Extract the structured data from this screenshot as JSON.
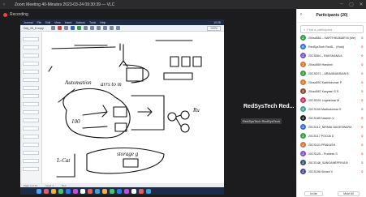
{
  "window": {
    "title": "Zoom Meeting 40-Minutes  2023-03-24 09:30:39 — VLC",
    "controls": [
      "–",
      "▢",
      "✕"
    ]
  },
  "recording": {
    "label": "Recording"
  },
  "shared_app": {
    "menu": [
      "Journal",
      "File",
      "Edit",
      "View",
      "Insert",
      "Actions",
      "Tools",
      "Help"
    ],
    "clock": "10:05",
    "file_name": "Day_26_D.xopp",
    "zoom": "100%",
    "status": [
      "Page 4 of 12",
      "Layer 1",
      "Pen"
    ]
  },
  "speaker": {
    "name": "RedSysTech  Red...",
    "tag": "RedSysTech  RedSysTech"
  },
  "participants_panel": {
    "title": "Participants (20)",
    "search_placeholder": "Find a participant",
    "participants": [
      {
        "initial": "Z",
        "name": "20csd084 – KARTHIKUMAR M (Me)",
        "color": "#3a9a4a"
      },
      {
        "initial": "R",
        "name": "RedSysTech RedS... (Host)",
        "color": "#3b6fd4"
      },
      {
        "initial": "Z",
        "name": "20CS064 – RAKSHANA A",
        "color": "#7a56c7"
      },
      {
        "initial": "Z",
        "name": "20csd069 Harshini",
        "color": "#d1793a"
      },
      {
        "initial": "Z",
        "name": "20CSD71 – ARAVANANDAN B",
        "color": "#3a9a4a"
      },
      {
        "initial": "Z",
        "name": "20csd092 Karthikkumar P",
        "color": "#d1793a"
      },
      {
        "initial": "Z",
        "name": "20csd087 Kavyasri S S",
        "color": "#8b4a3a"
      },
      {
        "initial": "Z",
        "name": "20CSD91 Logeshwar M",
        "color": "#c23b6a"
      },
      {
        "initial": "Z",
        "name": "20CS106 Madhukumar S",
        "color": "#4aa3a3"
      },
      {
        "initial": "Z",
        "name": "20CS185 Naveen V",
        "color": "#222222"
      },
      {
        "initial": "Z",
        "name": "20CS112_NIRMAI NAGESWARA",
        "color": "#3b6fd4"
      },
      {
        "initial": "Z",
        "name": "20CS117 POOJA D",
        "color": "#3a9a4a"
      },
      {
        "initial": "Z",
        "name": "20CS121 PRAKASH",
        "color": "#d1793a"
      },
      {
        "initial": "Z",
        "name": "20CS125 – Pranesh S",
        "color": "#7a56c7"
      },
      {
        "initial": "Z",
        "name": "20CS146_SANGAMEPRIYA B",
        "color": "#3b4f7a"
      },
      {
        "initial": "Z",
        "name": "20CS198 Sriram V",
        "color": "#4a4a8a"
      }
    ],
    "footer": {
      "invite": "Invite",
      "mute_all": "Mute All"
    }
  }
}
